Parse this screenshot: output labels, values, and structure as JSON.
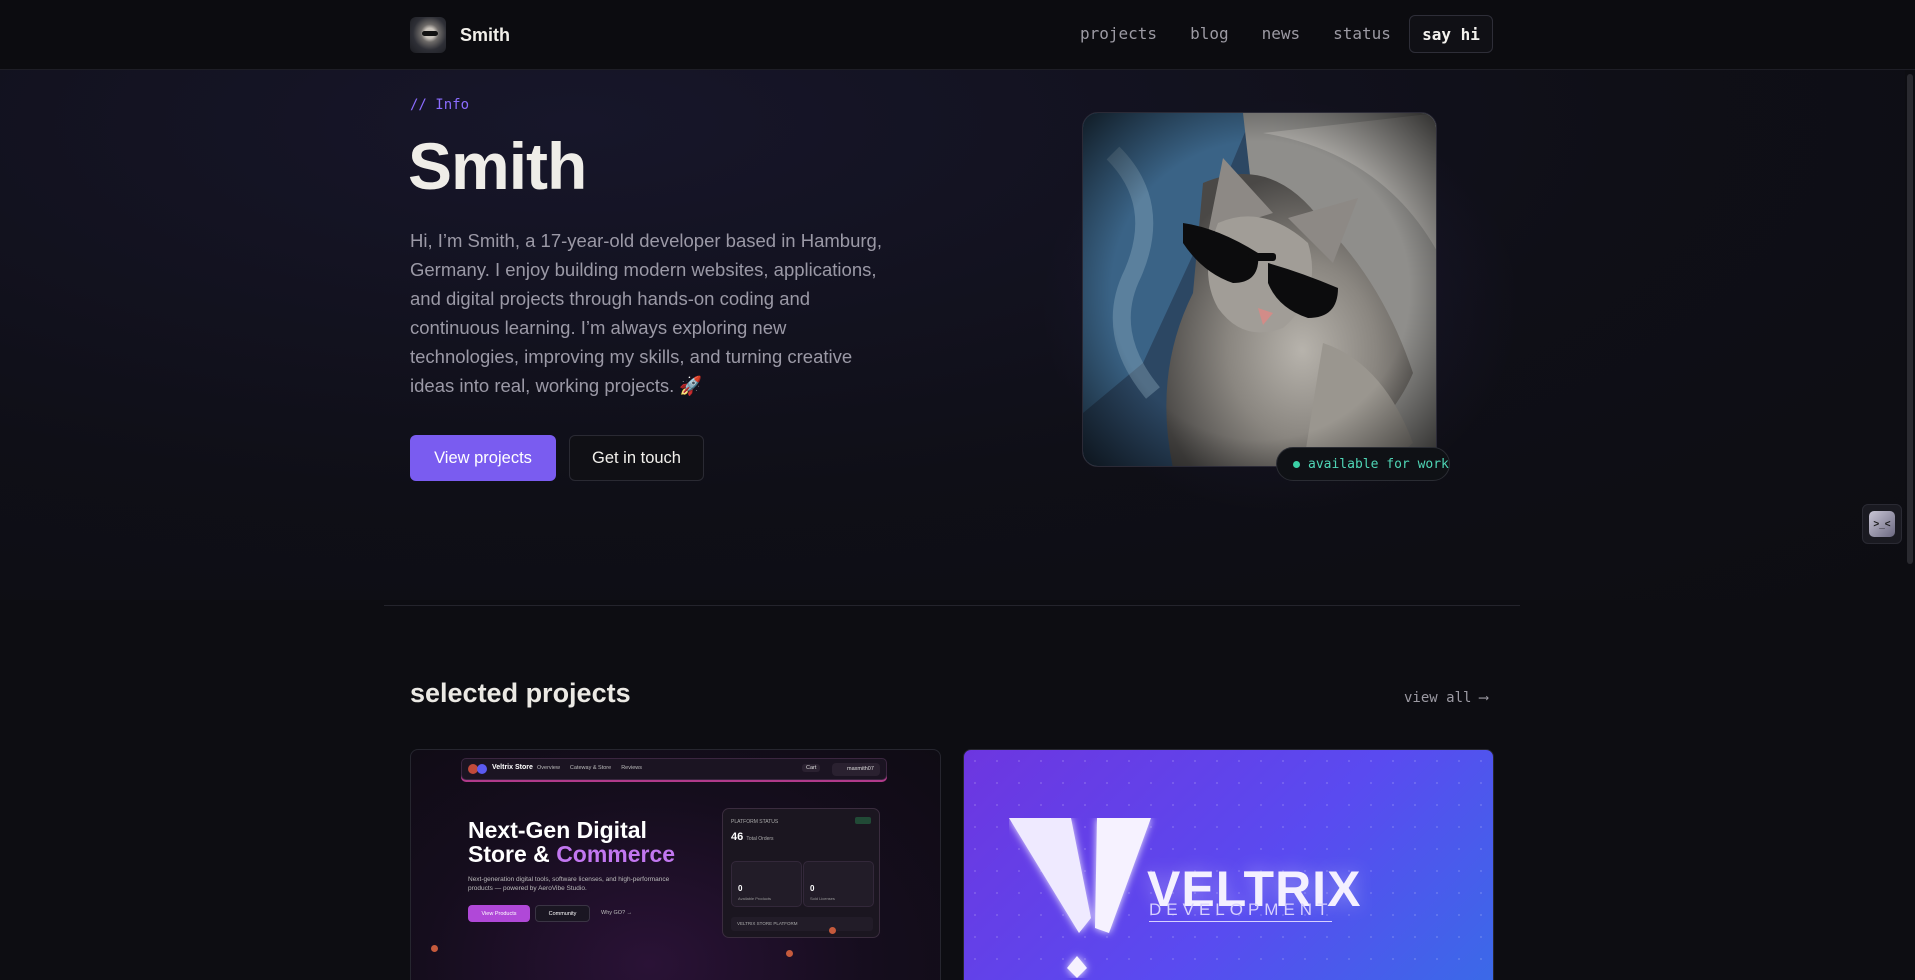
{
  "nav": {
    "brand": "Smith",
    "links": [
      "projects",
      "blog",
      "news",
      "status"
    ],
    "cta": "say hi"
  },
  "hero": {
    "eyebrow": "// Info",
    "title": "Smith",
    "description": "Hi, I’m Smith, a 17-year-old developer based in Hamburg, Germany. I enjoy building modern websites, applications, and digital projects through hands-on coding and continuous learning. I’m always exploring new technologies, improving my skills, and turning creative ideas into real, working projects. 🚀",
    "primary_button": "View projects",
    "secondary_button": "Get in touch",
    "status": "available for work"
  },
  "projects": {
    "title": "selected projects",
    "view_all": "view all",
    "view_all_arrow": "⟶",
    "card_a": {
      "brand": "Veltrix Store",
      "links": [
        "Overview",
        "Cateway & Store",
        "Reviews"
      ],
      "cart": "Cart",
      "user": "maxmith07",
      "headline_1": "Next-Gen Digital",
      "headline_2a": "Store & ",
      "headline_2b": "Commerce",
      "sub": "Next-generation digital tools, software licenses, and high-performance products — powered by AeroVibe Studio.",
      "btn_view": "View Products",
      "btn_community": "Community",
      "btn_why": "Why GO? →",
      "panel_head": "PLATFORM STATUS",
      "panel_big": "46",
      "panel_big_unit": "Total Orders",
      "tile1_num": "0",
      "tile1_lbl": "Available Products",
      "tile2_num": "0",
      "tile2_lbl": "Sold Licenses",
      "footer": "VELTRIX STORE PLATFORM"
    },
    "card_b": {
      "wordmark": "VELTRIX",
      "sub": "DEVELOPMENT"
    }
  },
  "colors": {
    "accent": "#7a5cf0",
    "status": "#3ad0a5",
    "background": "#0d0d12"
  },
  "icons": {
    "status_dot": "status-dot-icon",
    "side_widget": "emoji-face-icon",
    "arrow": "arrow-right-icon"
  }
}
